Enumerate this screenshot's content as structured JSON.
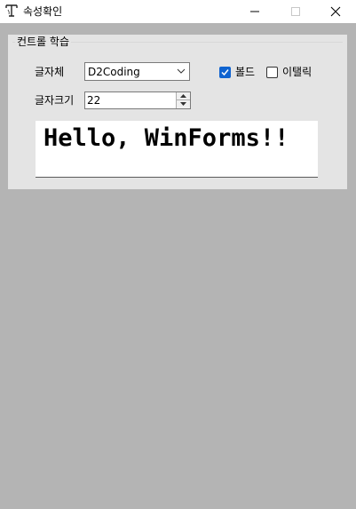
{
  "window": {
    "title": "속성확인",
    "icon": "app-icon",
    "controls": {
      "minimize_icon": "minimize-icon",
      "maximize_icon": "maximize-icon",
      "close_icon": "close-icon"
    }
  },
  "group": {
    "legend": "컨트롤 학습"
  },
  "font_label": "글자체",
  "font_combo": {
    "value": "D2Coding",
    "icon": "chevron-down-icon"
  },
  "bold": {
    "label": "볼드",
    "checked": true,
    "color": "#0f63d0"
  },
  "italic": {
    "label": "이탤릭",
    "checked": false
  },
  "size_label": "글자크기",
  "size_spinner": {
    "value": "22"
  },
  "preview": {
    "text": "Hello, WinForms!!"
  }
}
